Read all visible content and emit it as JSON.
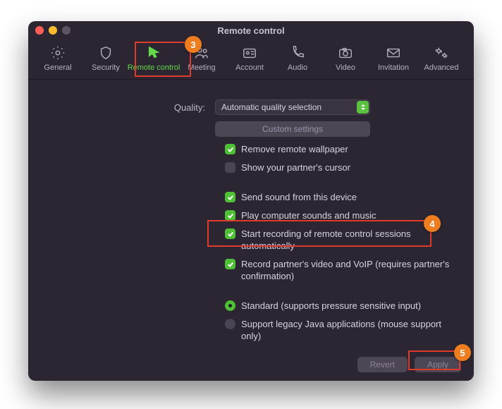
{
  "window_title": "Remote control",
  "tabs": [
    {
      "label": "General"
    },
    {
      "label": "Security"
    },
    {
      "label": "Remote control"
    },
    {
      "label": "Meeting"
    },
    {
      "label": "Account"
    },
    {
      "label": "Audio"
    },
    {
      "label": "Video"
    },
    {
      "label": "Invitation"
    },
    {
      "label": "Advanced"
    }
  ],
  "quality_label": "Quality:",
  "quality_value": "Automatic quality selection",
  "custom_settings": "Custom settings",
  "options": {
    "remove_wallpaper": {
      "label": "Remove remote wallpaper",
      "checked": true
    },
    "show_cursor": {
      "label": "Show your partner's cursor",
      "checked": false
    },
    "send_sound": {
      "label": "Send sound from this device",
      "checked": true
    },
    "play_sounds": {
      "label": "Play computer sounds and music",
      "checked": true
    },
    "start_recording": {
      "label": "Start recording of remote control sessions automatically",
      "checked": true
    },
    "record_voip": {
      "label": "Record partner's video and VoIP (requires partner's confirmation)",
      "checked": true
    }
  },
  "input_mode": {
    "standard": {
      "label": "Standard (supports pressure sensitive input)",
      "selected": true
    },
    "legacy": {
      "label": "Support legacy Java applications (mouse support only)",
      "selected": false
    }
  },
  "footer": {
    "revert": "Revert",
    "apply": "Apply"
  },
  "annotations": {
    "badge3": "3",
    "badge4": "4",
    "badge5": "5"
  }
}
